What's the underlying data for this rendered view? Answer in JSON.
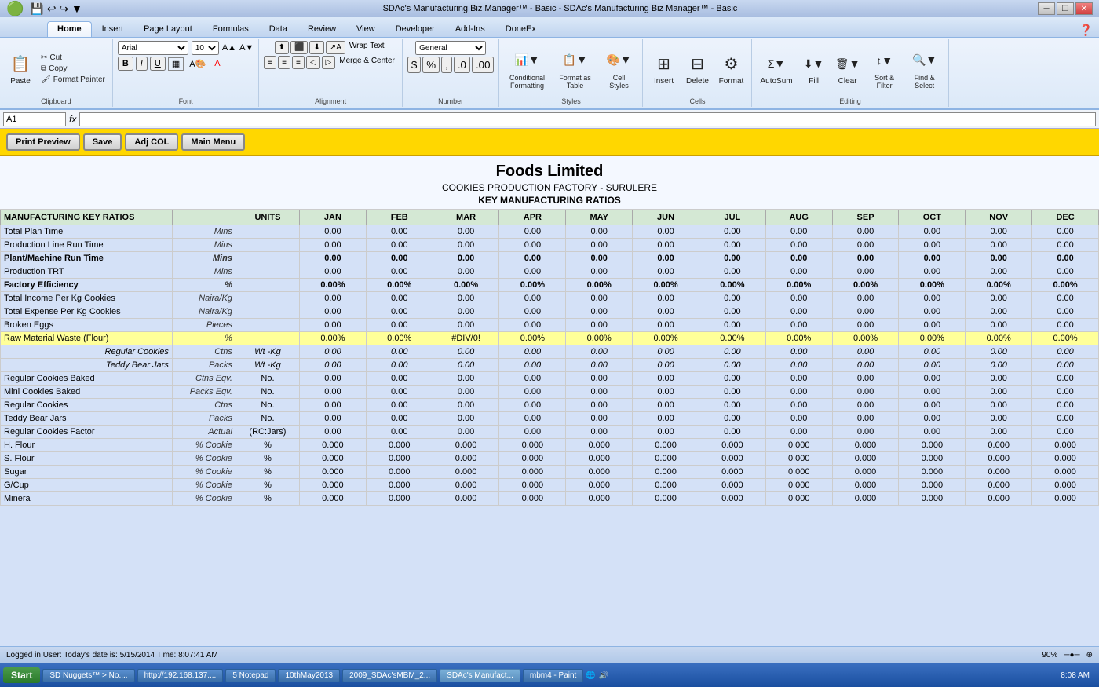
{
  "titlebar": {
    "title": "SDAc's Manufacturing Biz Manager™ - Basic - SDAc's Manufacturing Biz Manager™ - Basic",
    "logo": "🟢"
  },
  "ribbon": {
    "tabs": [
      "Home",
      "Insert",
      "Page Layout",
      "Formulas",
      "Data",
      "Review",
      "View",
      "Developer",
      "Add-Ins",
      "DoneEx"
    ],
    "active_tab": "Home",
    "groups": {
      "clipboard": {
        "label": "Clipboard",
        "paste_label": "Paste",
        "cut_label": "Cut",
        "copy_label": "Copy",
        "format_painter_label": "Format Painter"
      },
      "font": {
        "label": "Font",
        "font_name": "Arial",
        "font_size": "10"
      },
      "alignment": {
        "label": "Alignment",
        "wrap_text": "Wrap Text",
        "merge_center": "Merge & Center"
      },
      "number": {
        "label": "Number"
      },
      "styles": {
        "label": "Styles",
        "conditional_formatting": "Conditional Formatting",
        "format_as_table": "Format as Table",
        "cell_styles": "Cell Styles"
      },
      "cells": {
        "label": "Cells",
        "insert": "Insert",
        "delete": "Delete",
        "format": "Format"
      },
      "editing": {
        "label": "Editing",
        "autosum": "AutoSum",
        "fill": "Fill",
        "clear": "Clear",
        "sort_filter": "Sort & Filter",
        "find_select": "Find & Select"
      }
    }
  },
  "formula_bar": {
    "name_box": "A1",
    "formula": ""
  },
  "toolbar": {
    "print_preview": "Print Preview",
    "save": "Save",
    "adj_col": "Adj COL",
    "main_menu": "Main Menu"
  },
  "header": {
    "company": "Foods Limited",
    "subtitle": "COOKIES PRODUCTION FACTORY - SURULERE",
    "section": "KEY MANUFACTURING RATIOS"
  },
  "table": {
    "columns": {
      "label": "MANUFACTURING KEY RATIOS",
      "sub": "",
      "units": "UNITS",
      "jan": "JAN",
      "feb": "FEB",
      "mar": "MAR",
      "apr": "APR",
      "may": "MAY",
      "jun": "JUN",
      "jul": "JUL",
      "aug": "AUG",
      "sep": "SEP",
      "oct": "OCT",
      "nov": "NOV",
      "dec": "DEC"
    },
    "rows": [
      {
        "label": "Total Plan Time",
        "sub": "",
        "units": "Mins",
        "style": "normal",
        "values": [
          "0.00",
          "0.00",
          "0.00",
          "0.00",
          "0.00",
          "0.00",
          "0.00",
          "0.00",
          "0.00",
          "0.00",
          "0.00",
          "0.00"
        ]
      },
      {
        "label": "Production Line Run Time",
        "sub": "",
        "units": "Mins",
        "style": "normal",
        "values": [
          "0.00",
          "0.00",
          "0.00",
          "0.00",
          "0.00",
          "0.00",
          "0.00",
          "0.00",
          "0.00",
          "0.00",
          "0.00",
          "0.00"
        ]
      },
      {
        "label": "Plant/Machine Run Time",
        "sub": "",
        "units": "Mins",
        "style": "bold",
        "values": [
          "0.00",
          "0.00",
          "0.00",
          "0.00",
          "0.00",
          "0.00",
          "0.00",
          "0.00",
          "0.00",
          "0.00",
          "0.00",
          "0.00"
        ]
      },
      {
        "label": "Production TRT",
        "sub": "",
        "units": "Mins",
        "style": "normal",
        "values": [
          "0.00",
          "0.00",
          "0.00",
          "0.00",
          "0.00",
          "0.00",
          "0.00",
          "0.00",
          "0.00",
          "0.00",
          "0.00",
          "0.00"
        ]
      },
      {
        "label": "Factory Efficiency",
        "sub": "",
        "units": "%",
        "style": "bold",
        "values": [
          "0.00%",
          "0.00%",
          "0.00%",
          "0.00%",
          "0.00%",
          "0.00%",
          "0.00%",
          "0.00%",
          "0.00%",
          "0.00%",
          "0.00%",
          "0.00%"
        ]
      },
      {
        "label": "Total Income Per Kg Cookies",
        "sub": "",
        "units": "Naira/Kg",
        "style": "normal",
        "values": [
          "0.00",
          "0.00",
          "0.00",
          "0.00",
          "0.00",
          "0.00",
          "0.00",
          "0.00",
          "0.00",
          "0.00",
          "0.00",
          "0.00"
        ]
      },
      {
        "label": "Total Expense Per Kg Cookies",
        "sub": "",
        "units": "Naira/Kg",
        "style": "normal",
        "values": [
          "0.00",
          "0.00",
          "0.00",
          "0.00",
          "0.00",
          "0.00",
          "0.00",
          "0.00",
          "0.00",
          "0.00",
          "0.00",
          "0.00"
        ]
      },
      {
        "label": "Broken Eggs",
        "sub": "",
        "units": "Pieces",
        "style": "normal",
        "values": [
          "0.00",
          "0.00",
          "0.00",
          "0.00",
          "0.00",
          "0.00",
          "0.00",
          "0.00",
          "0.00",
          "0.00",
          "0.00",
          "0.00"
        ]
      },
      {
        "label": "Raw Material Waste (Flour)",
        "sub": "",
        "units": "%",
        "style": "yellow",
        "values": [
          "0.00%",
          "0.00%",
          "#DIV/0!",
          "0.00%",
          "0.00%",
          "0.00%",
          "0.00%",
          "0.00%",
          "0.00%",
          "0.00%",
          "0.00%",
          "0.00%"
        ]
      },
      {
        "label": "",
        "sub": "Regular Cookies",
        "units": "Ctns",
        "sub2": "Wt -Kg",
        "style": "italic",
        "values": [
          "0.00",
          "0.00",
          "0.00",
          "0.00",
          "0.00",
          "0.00",
          "0.00",
          "0.00",
          "0.00",
          "0.00",
          "0.00",
          "0.00"
        ]
      },
      {
        "label": "",
        "sub": "Teddy Bear Jars",
        "units": "Packs",
        "sub2": "Wt -Kg",
        "style": "italic",
        "values": [
          "0.00",
          "0.00",
          "0.00",
          "0.00",
          "0.00",
          "0.00",
          "0.00",
          "0.00",
          "0.00",
          "0.00",
          "0.00",
          "0.00"
        ]
      },
      {
        "label": "Regular Cookies Baked",
        "sub": "",
        "units": "Ctns Eqv.",
        "sub2": "No.",
        "style": "normal",
        "values": [
          "0.00",
          "0.00",
          "0.00",
          "0.00",
          "0.00",
          "0.00",
          "0.00",
          "0.00",
          "0.00",
          "0.00",
          "0.00",
          "0.00"
        ]
      },
      {
        "label": "Mini Cookies Baked",
        "sub": "",
        "units": "Packs Eqv.",
        "sub2": "No.",
        "style": "normal",
        "values": [
          "0.00",
          "0.00",
          "0.00",
          "0.00",
          "0.00",
          "0.00",
          "0.00",
          "0.00",
          "0.00",
          "0.00",
          "0.00",
          "0.00"
        ]
      },
      {
        "label": "Regular Cookies",
        "sub": "",
        "units": "Ctns",
        "sub2": "No.",
        "style": "normal",
        "values": [
          "0.00",
          "0.00",
          "0.00",
          "0.00",
          "0.00",
          "0.00",
          "0.00",
          "0.00",
          "0.00",
          "0.00",
          "0.00",
          "0.00"
        ]
      },
      {
        "label": "Teddy Bear Jars",
        "sub": "",
        "units": "Packs",
        "sub2": "No.",
        "style": "normal",
        "values": [
          "0.00",
          "0.00",
          "0.00",
          "0.00",
          "0.00",
          "0.00",
          "0.00",
          "0.00",
          "0.00",
          "0.00",
          "0.00",
          "0.00"
        ]
      },
      {
        "label": "Regular Cookies Factor",
        "sub": "",
        "units": "Actual",
        "sub2": "(RC:Jars)",
        "style": "normal",
        "values": [
          "0.00",
          "0.00",
          "0.00",
          "0.00",
          "0.00",
          "0.00",
          "0.00",
          "0.00",
          "0.00",
          "0.00",
          "0.00",
          "0.00"
        ]
      },
      {
        "label": "H. Flour",
        "sub": "",
        "units": "% Cookie",
        "sub2": "%",
        "style": "normal",
        "values": [
          "0.000",
          "0.000",
          "0.000",
          "0.000",
          "0.000",
          "0.000",
          "0.000",
          "0.000",
          "0.000",
          "0.000",
          "0.000",
          "0.000"
        ]
      },
      {
        "label": "S. Flour",
        "sub": "",
        "units": "% Cookie",
        "sub2": "%",
        "style": "normal",
        "values": [
          "0.000",
          "0.000",
          "0.000",
          "0.000",
          "0.000",
          "0.000",
          "0.000",
          "0.000",
          "0.000",
          "0.000",
          "0.000",
          "0.000"
        ]
      },
      {
        "label": "Sugar",
        "sub": "",
        "units": "% Cookie",
        "sub2": "%",
        "style": "normal",
        "values": [
          "0.000",
          "0.000",
          "0.000",
          "0.000",
          "0.000",
          "0.000",
          "0.000",
          "0.000",
          "0.000",
          "0.000",
          "0.000",
          "0.000"
        ]
      },
      {
        "label": "G/Cup",
        "sub": "",
        "units": "% Cookie",
        "sub2": "%",
        "style": "normal",
        "values": [
          "0.000",
          "0.000",
          "0.000",
          "0.000",
          "0.000",
          "0.000",
          "0.000",
          "0.000",
          "0.000",
          "0.000",
          "0.000",
          "0.000"
        ]
      },
      {
        "label": "Minera",
        "sub": "",
        "units": "% Cookie",
        "sub2": "%",
        "style": "normal",
        "values": [
          "0.000",
          "0.000",
          "0.000",
          "0.000",
          "0.000",
          "0.000",
          "0.000",
          "0.000",
          "0.000",
          "0.000",
          "0.000",
          "0.000"
        ]
      }
    ]
  },
  "status_bar": {
    "text": "Logged in User:  Today's date is: 5/15/2014  Time: 8:07:41 AM",
    "zoom": "90%"
  },
  "taskbar": {
    "start": "Start",
    "items": [
      {
        "label": "SD Nuggets™ > No....",
        "active": false
      },
      {
        "label": "http://192.168.137....",
        "active": false
      },
      {
        "label": "5 Notepad",
        "active": false
      },
      {
        "label": "10thMay2013",
        "active": false
      },
      {
        "label": "2009_SDAc'sMBM_2...",
        "active": false
      },
      {
        "label": "SDAc's Manufact...",
        "active": true
      },
      {
        "label": "mbm4 - Paint",
        "active": false
      }
    ],
    "time": "8:08 AM"
  }
}
